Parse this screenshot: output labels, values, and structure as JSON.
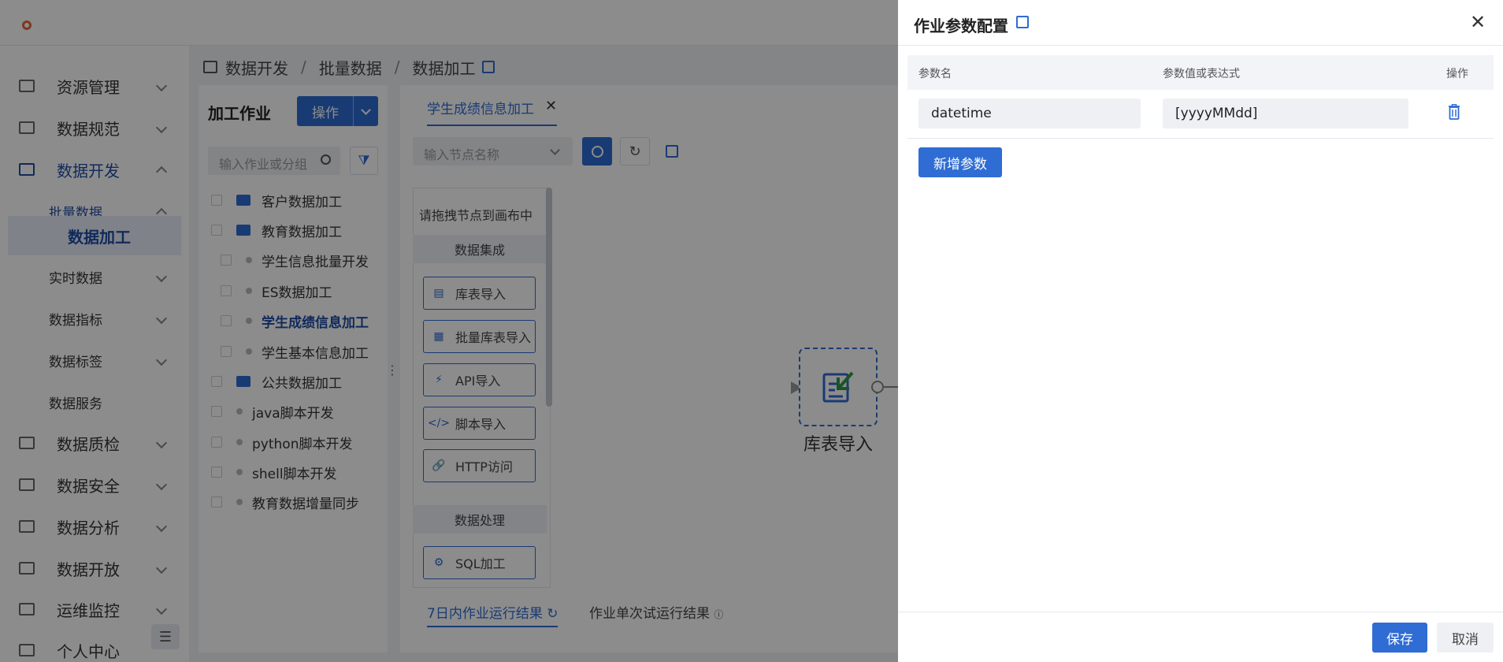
{
  "sidebar": {
    "items": [
      {
        "label": "资源管理",
        "icon": "resource-icon"
      },
      {
        "label": "数据规范",
        "icon": "standard-icon"
      },
      {
        "label": "数据开发",
        "icon": "dev-icon"
      },
      {
        "label": "批量数据"
      },
      {
        "label": "数据加工"
      },
      {
        "label": "实时数据"
      },
      {
        "label": "数据指标"
      },
      {
        "label": "数据标签"
      },
      {
        "label": "数据服务"
      },
      {
        "label": "数据质检",
        "icon": "quality-icon"
      },
      {
        "label": "数据安全",
        "icon": "security-icon"
      },
      {
        "label": "数据分析",
        "icon": "analysis-icon"
      },
      {
        "label": "数据开放",
        "icon": "open-icon"
      },
      {
        "label": "运维监控",
        "icon": "monitor-icon"
      },
      {
        "label": "个人中心",
        "icon": "user-icon"
      }
    ]
  },
  "breadcrumb": [
    "数据开发",
    "批量数据",
    "数据加工"
  ],
  "jobs": {
    "title": "加工作业",
    "op_button": "操作",
    "search_placeholder": "输入作业或分组",
    "tree": [
      {
        "label": "客户数据加工",
        "type": "folder"
      },
      {
        "label": "教育数据加工",
        "type": "folder-open"
      },
      {
        "label": "学生信息批量开发",
        "type": "item"
      },
      {
        "label": "ES数据加工",
        "type": "item"
      },
      {
        "label": "学生成绩信息加工",
        "type": "item",
        "selected": true
      },
      {
        "label": "学生基本信息加工",
        "type": "item"
      },
      {
        "label": "公共数据加工",
        "type": "folder"
      },
      {
        "label": "java脚本开发",
        "type": "item"
      },
      {
        "label": "python脚本开发",
        "type": "item"
      },
      {
        "label": "shell脚本开发",
        "type": "item"
      },
      {
        "label": "教育数据增量同步",
        "type": "item"
      }
    ]
  },
  "editor": {
    "tab": "学生成绩信息加工",
    "node_search_placeholder": "输入节点名称",
    "palette_hint": "请拖拽节点到画布中",
    "groups": [
      "数据集成",
      "数据处理"
    ],
    "nodes": [
      "库表导入",
      "批量库表导入",
      "API导入",
      "脚本导入",
      "HTTP访问",
      "SQL加工"
    ],
    "canvas_node_label": "库表导入",
    "bottom_tabs": [
      "7日内作业运行结果",
      "作业单次试运行结果"
    ]
  },
  "drawer": {
    "title": "作业参数配置",
    "columns": [
      "参数名",
      "参数值或表达式",
      "操作"
    ],
    "params": [
      {
        "name": "datetime",
        "value": "[yyyyMMdd]"
      }
    ],
    "add_label": "新增参数",
    "save_label": "保存",
    "cancel_label": "取消"
  },
  "colors": {
    "accent": "#2f6cd4",
    "logo": "#e8673a"
  }
}
